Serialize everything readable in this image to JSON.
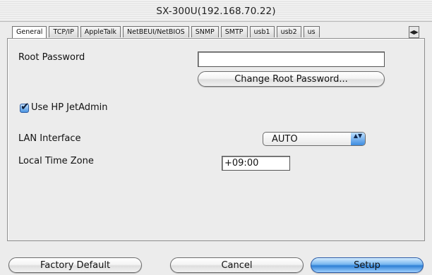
{
  "window": {
    "title": "SX-300U(192.168.70.22)"
  },
  "tabs": [
    {
      "label": "General"
    },
    {
      "label": "TCP/IP"
    },
    {
      "label": "AppleTalk"
    },
    {
      "label": "NetBEUI/NetBIOS"
    },
    {
      "label": "SNMP"
    },
    {
      "label": "SMTP"
    },
    {
      "label": "usb1"
    },
    {
      "label": "usb2"
    },
    {
      "label": "us"
    }
  ],
  "tab_scroll": {
    "left": "◀",
    "right": "▶"
  },
  "general": {
    "root_password": {
      "label": "Root Password",
      "value": ""
    },
    "change_password_button": "Change Root Password...",
    "use_jetadmin": {
      "label": "Use HP JetAdmin",
      "checked": true,
      "mark": "✔"
    },
    "lan_interface": {
      "label": "LAN Interface",
      "selected": "AUTO",
      "arrows": "▲▼"
    },
    "local_time_zone": {
      "label": "Local Time Zone",
      "value": "+09:00"
    }
  },
  "footer": {
    "factory_default": "Factory Default",
    "cancel": "Cancel",
    "setup": "Setup"
  },
  "colors": {
    "accent": "#3b88e0",
    "window_bg": "#ececec"
  }
}
